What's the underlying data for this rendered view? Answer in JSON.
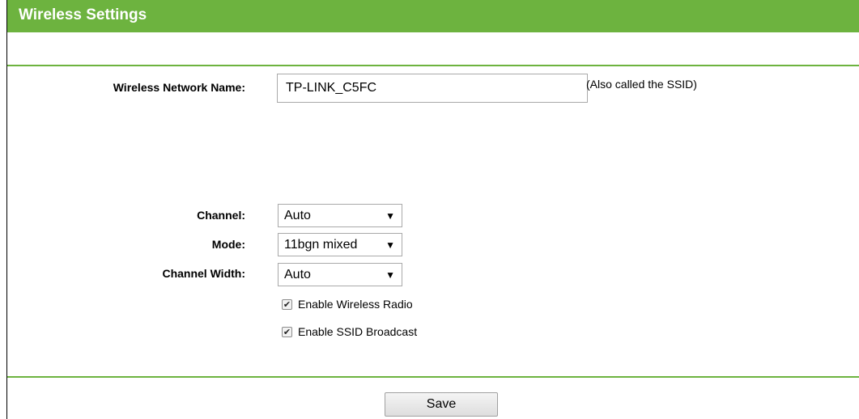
{
  "header": {
    "title": "Wireless Settings",
    "accent_color": "#6db33f"
  },
  "form": {
    "ssid": {
      "label": "Wireless Network Name:",
      "value": "TP-LINK_C5FC",
      "note": "(Also called the SSID)"
    },
    "channel": {
      "label": "Channel:",
      "selected": "Auto"
    },
    "mode": {
      "label": "Mode:",
      "selected": "11bgn mixed"
    },
    "channel_width": {
      "label": "Channel Width:",
      "selected": "Auto"
    },
    "enable_wireless_radio": {
      "label": "Enable Wireless Radio",
      "checked": true
    },
    "enable_ssid_broadcast": {
      "label": "Enable SSID Broadcast",
      "checked": true
    }
  },
  "actions": {
    "save_label": "Save"
  },
  "icons": {
    "dropdown_caret": "▼",
    "checkmark": "✔"
  }
}
